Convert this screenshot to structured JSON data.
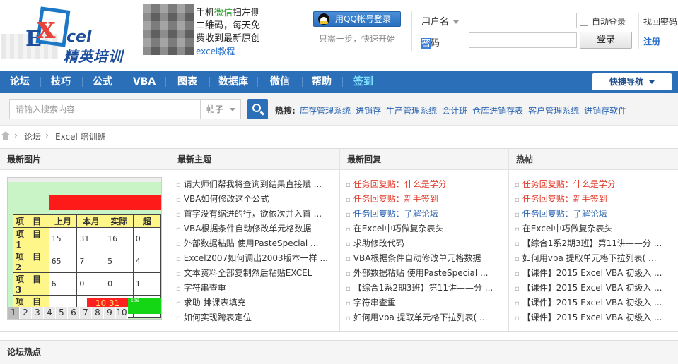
{
  "header": {
    "logo": {
      "brand": "Excel",
      "cn": "精英培训"
    },
    "qr_text": {
      "line1_a": "手机",
      "line1_b": "微信",
      "line1_c": "扫左侧",
      "line2": "二维码，每天免",
      "line3": "费收到最新原创",
      "line4": "excel教程"
    },
    "qq_login": "用QQ帐号登录",
    "qq_sub": "只需一步，快速开始",
    "username_label": "用户名",
    "password_label_a": "密",
    "password_label_b": "码",
    "auto_login": "自动登录",
    "login_button": "登录",
    "find_password": "找回密码",
    "register": "注册"
  },
  "nav": {
    "items": [
      "论坛",
      "技巧",
      "公式",
      "VBA",
      "图表",
      "数据库",
      "微信",
      "帮助",
      "签到"
    ],
    "quick_nav": "快捷导航"
  },
  "search": {
    "placeholder": "请输入搜索内容",
    "type": "帖子",
    "hot_label": "热搜:",
    "hot_links": [
      "库存管理系统",
      "进销存",
      "生产管理系统",
      "会计班",
      "仓库进销存表",
      "客户管理系统",
      "进销存软件"
    ]
  },
  "breadcrumb": {
    "sep": "›",
    "items": [
      "论坛",
      "Excel 培训班"
    ]
  },
  "panels": {
    "images": {
      "title": "最新图片",
      "sheet": {
        "header": [
          "项 目",
          "上月",
          "本月",
          "实际",
          "超"
        ],
        "rows": [
          [
            "项 目1",
            "15",
            "31",
            "16",
            "0"
          ],
          [
            "项 目2",
            "65",
            "7",
            "5",
            "4"
          ],
          [
            "项 目3",
            "6",
            "0",
            "0",
            "1"
          ],
          [
            "项 目3",
            "",
            "",
            "",
            ""
          ]
        ],
        "chip": "10 31",
        "chip_small": "106"
      },
      "pages": [
        "1",
        "2",
        "3",
        "4",
        "5",
        "6",
        "7",
        "8",
        "9",
        "10"
      ]
    },
    "topics": {
      "title": "最新主题",
      "items": [
        "请大师们帮我将查询到结果直接赋 ...",
        "VBA如何修改这个公式",
        "首字没有缩进的行，欲依次并入首 ...",
        "VBA根据条件自动修改单元格数据",
        "外部数据粘贴 使用PasteSpecial ...",
        "Excel2007如何调出2003版本一样 ...",
        "文本资料全部复制然后粘贴EXCEL",
        "字符串查重",
        "求助 排课表填充",
        "如何实现跨表定位"
      ]
    },
    "replies": {
      "title": "最新回复",
      "items": [
        {
          "text": "任务回复贴：什么是学分",
          "color": "red"
        },
        {
          "text": "任务回复贴：新手签到",
          "color": "red"
        },
        {
          "text": "任务回复贴：了解论坛",
          "color": "blue"
        },
        {
          "text": "在Excel中巧做复杂表头",
          "color": ""
        },
        {
          "text": "求助修改代码",
          "color": ""
        },
        {
          "text": "VBA根据条件自动修改单元格数据",
          "color": ""
        },
        {
          "text": "外部数据粘贴 使用PasteSpecial ...",
          "color": ""
        },
        {
          "text": "【综合1系2期3班】第11讲——分 ...",
          "color": ""
        },
        {
          "text": "字符串查重",
          "color": ""
        },
        {
          "text": "如何用vba 提取单元格下拉列表( ...",
          "color": ""
        }
      ]
    },
    "hot": {
      "title": "热帖",
      "items": [
        {
          "text": "任务回复贴：什么是学分",
          "color": "red"
        },
        {
          "text": "任务回复贴：新手签到",
          "color": "red"
        },
        {
          "text": "任务回复贴：了解论坛",
          "color": "blue"
        },
        {
          "text": "在Excel中巧做复杂表头",
          "color": ""
        },
        {
          "text": "【综合1系2期3班】第11讲——分 ...",
          "color": ""
        },
        {
          "text": "如何用vba 提取单元格下拉列表( ...",
          "color": ""
        },
        {
          "text": "【课件】2015 Excel VBA 初级入 ...",
          "color": ""
        },
        {
          "text": "【课件】2015 Excel VBA 初级入 ...",
          "color": ""
        },
        {
          "text": "【课件】2015 Excel VBA 初级入 ...",
          "color": ""
        },
        {
          "text": "【课件】2015 Excel VBA 初级入 ...",
          "color": ""
        }
      ]
    }
  },
  "forum_hot_title": "论坛热点"
}
